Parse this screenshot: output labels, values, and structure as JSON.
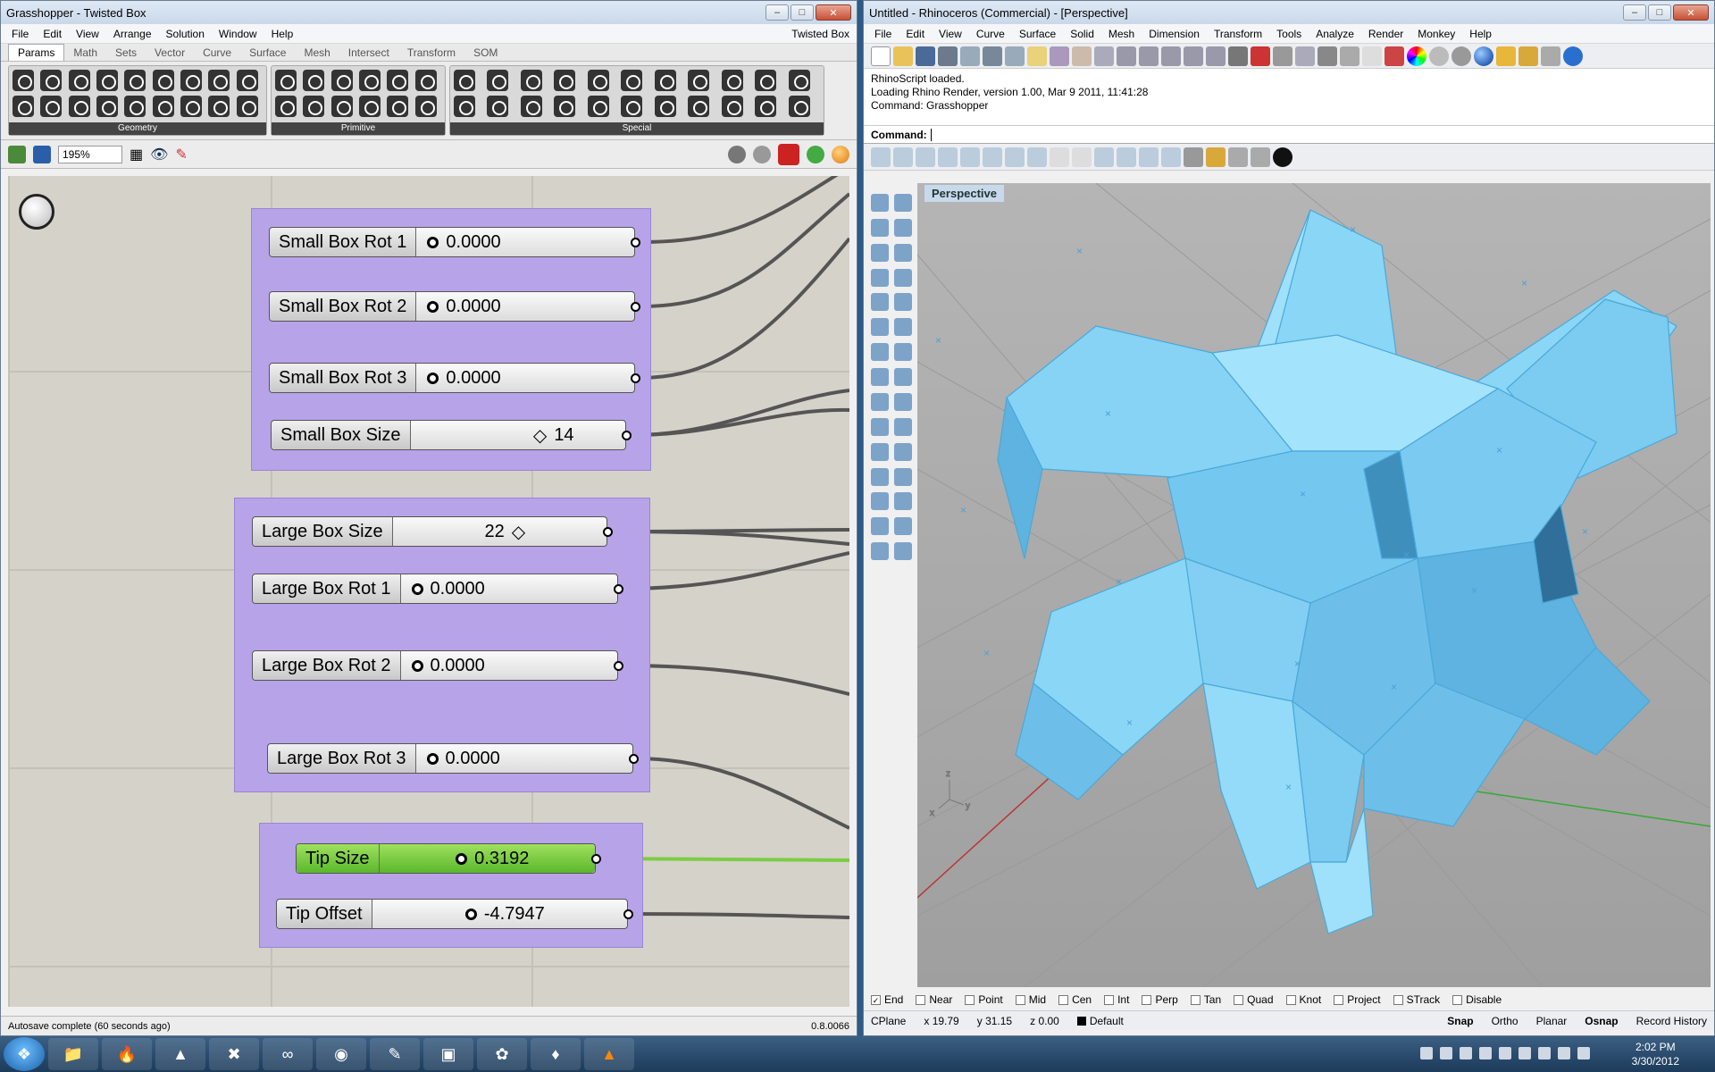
{
  "grasshopper": {
    "title": "Grasshopper - Twisted Box",
    "doc_name": "Twisted Box",
    "menu": [
      "File",
      "Edit",
      "View",
      "Arrange",
      "Solution",
      "Window",
      "Help"
    ],
    "tabs": [
      "Params",
      "Math",
      "Sets",
      "Vector",
      "Curve",
      "Surface",
      "Mesh",
      "Intersect",
      "Transform",
      "SOM"
    ],
    "active_tab": "Params",
    "ribbon_groups": [
      "Geometry",
      "Primitive",
      "Special"
    ],
    "zoom": "195%",
    "sliders": [
      {
        "name": "Small Box Rot 1",
        "value": "0.0000"
      },
      {
        "name": "Small Box Rot 2",
        "value": "0.0000"
      },
      {
        "name": "Small Box Rot 3",
        "value": "0.0000"
      },
      {
        "name": "Small Box Size",
        "value": "14"
      },
      {
        "name": "Large Box Size",
        "value": "22"
      },
      {
        "name": "Large Box Rot 1",
        "value": "0.0000"
      },
      {
        "name": "Large Box Rot 2",
        "value": "0.0000"
      },
      {
        "name": "Large Box Rot 3",
        "value": "0.0000"
      },
      {
        "name": "Tip Size",
        "value": "0.3192"
      },
      {
        "name": "Tip Offset",
        "value": "-4.7947"
      }
    ],
    "status": "Autosave complete (60 seconds ago)",
    "version": "0.8.0066"
  },
  "rhino": {
    "title": "Untitled - Rhinoceros (Commercial) - [Perspective]",
    "menu": [
      "File",
      "Edit",
      "View",
      "Curve",
      "Surface",
      "Solid",
      "Mesh",
      "Dimension",
      "Transform",
      "Tools",
      "Analyze",
      "Render",
      "Monkey",
      "Help"
    ],
    "history": [
      "RhinoScript loaded.",
      "Loading Rhino Render, version 1.00, Mar  9 2011, 11:41:28",
      "Command: Grasshopper"
    ],
    "command_label": "Command:",
    "viewport_label": "Perspective",
    "osnaps": [
      {
        "label": "End",
        "checked": true
      },
      {
        "label": "Near",
        "checked": false
      },
      {
        "label": "Point",
        "checked": false
      },
      {
        "label": "Mid",
        "checked": false
      },
      {
        "label": "Cen",
        "checked": false
      },
      {
        "label": "Int",
        "checked": false
      },
      {
        "label": "Perp",
        "checked": false
      },
      {
        "label": "Tan",
        "checked": false
      },
      {
        "label": "Quad",
        "checked": false
      },
      {
        "label": "Knot",
        "checked": false
      },
      {
        "label": "Project",
        "checked": false
      },
      {
        "label": "STrack",
        "checked": false
      },
      {
        "label": "Disable",
        "checked": false
      }
    ],
    "status": {
      "cplane": "CPlane",
      "x": "x 19.79",
      "y": "y 31.15",
      "z": "z 0.00",
      "layer": "Default",
      "snap": "Snap",
      "ortho": "Ortho",
      "planar": "Planar",
      "osnap": "Osnap",
      "record": "Record History"
    }
  },
  "taskbar": {
    "time": "2:02 PM",
    "date": "3/30/2012"
  },
  "colors": {
    "group_purple": "#b7a3e8",
    "slider_green": "#7ccc45",
    "model_blue": "#7fd0f5",
    "canvas": "#d5d2ca",
    "viewport_bg": "#a8a8a8"
  }
}
